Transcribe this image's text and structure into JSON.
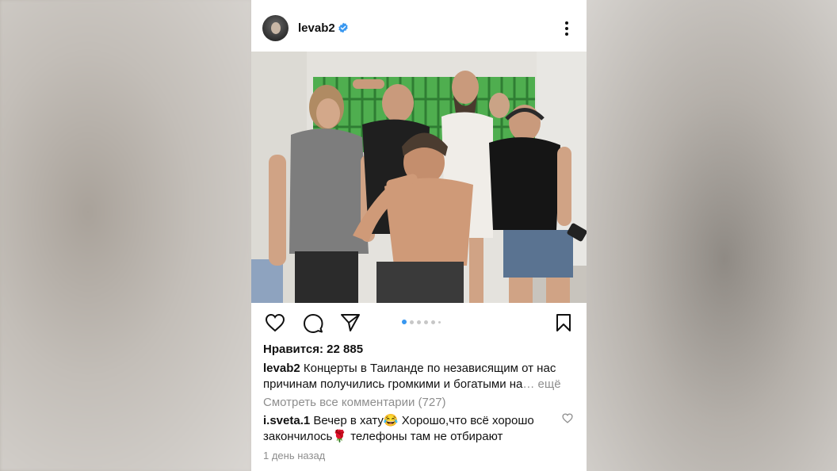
{
  "post": {
    "username": "levab2",
    "verified": true,
    "likes_label": "Нравится: 22 885",
    "caption_user": "levab2",
    "caption_text": " Концерты в Таиланде по независящим от нас причинам получились громкими и богатыми на",
    "caption_more": "… ещё",
    "view_all_comments": "Смотреть все комментарии (727)",
    "comment_user": "i.sveta.1",
    "comment_text": " Вечер в хату😂 Хорошо,что всё хорошо закончилось🌹 телефоны там не отбирают",
    "time_ago": "1 день назад",
    "carousel": {
      "total": 6,
      "active": 1
    }
  },
  "icons": {
    "like": "heart-icon",
    "comment": "comment-icon",
    "share": "send-icon",
    "save": "bookmark-icon",
    "more": "more-vertical-icon",
    "verified": "verified-badge-icon"
  },
  "colors": {
    "verified_blue": "#3897f0",
    "active_dot": "#3897f0",
    "muted_text": "#8e8e8e"
  }
}
